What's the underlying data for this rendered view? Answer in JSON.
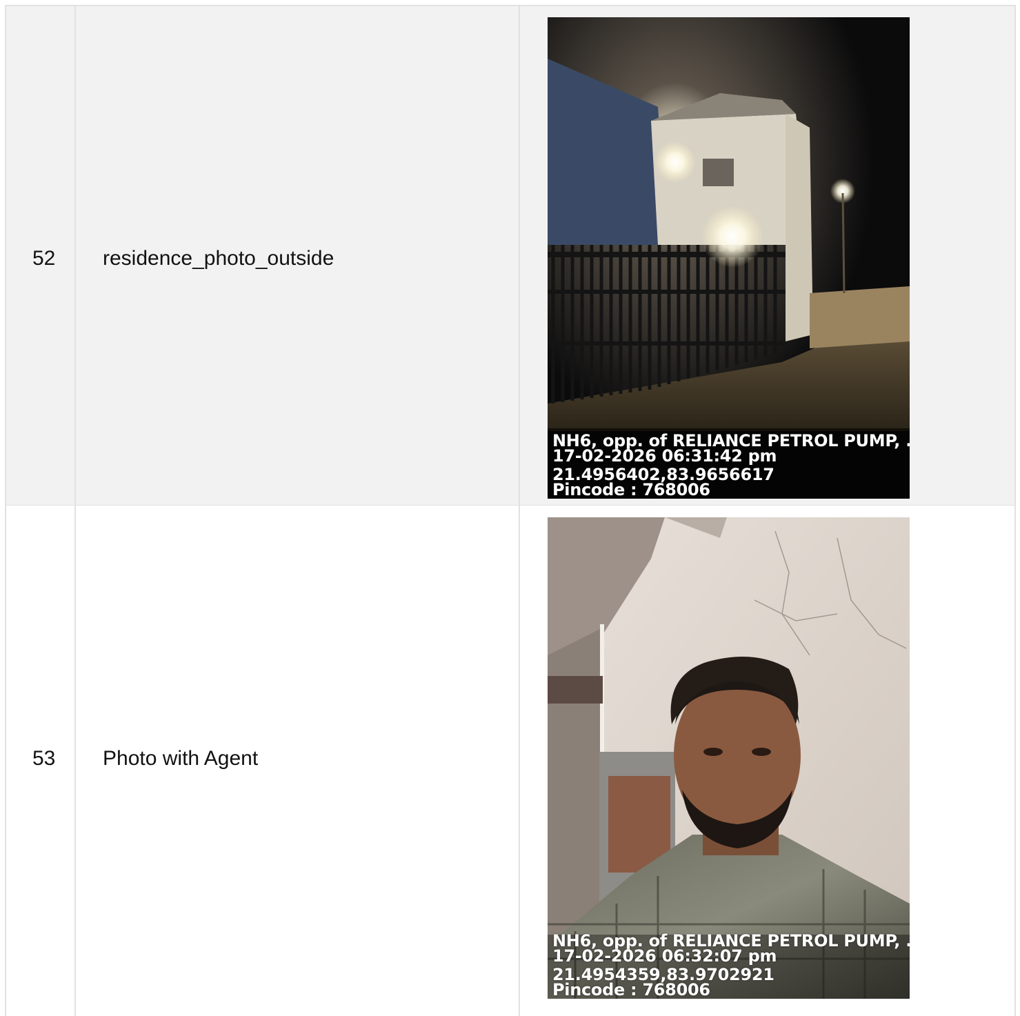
{
  "rows": [
    {
      "number": "52",
      "label": "residence_photo_outside",
      "photo": {
        "icon": "night-residence-photo",
        "address": "NH6, opp. of RELIANCE PETROL PUMP, ...",
        "datetime": "17-02-2026 06:31:42 pm",
        "coords": "21.4956402,83.9656617",
        "pincode": "Pincode : 768006"
      }
    },
    {
      "number": "53",
      "label": "Photo with Agent",
      "photo": {
        "icon": "agent-selfie-photo",
        "address": "NH6, opp. of RELIANCE PETROL PUMP, ...",
        "datetime": "17-02-2026 06:32:07 pm",
        "coords": "21.4954359,83.9702921",
        "pincode": "Pincode : 768006"
      }
    }
  ]
}
